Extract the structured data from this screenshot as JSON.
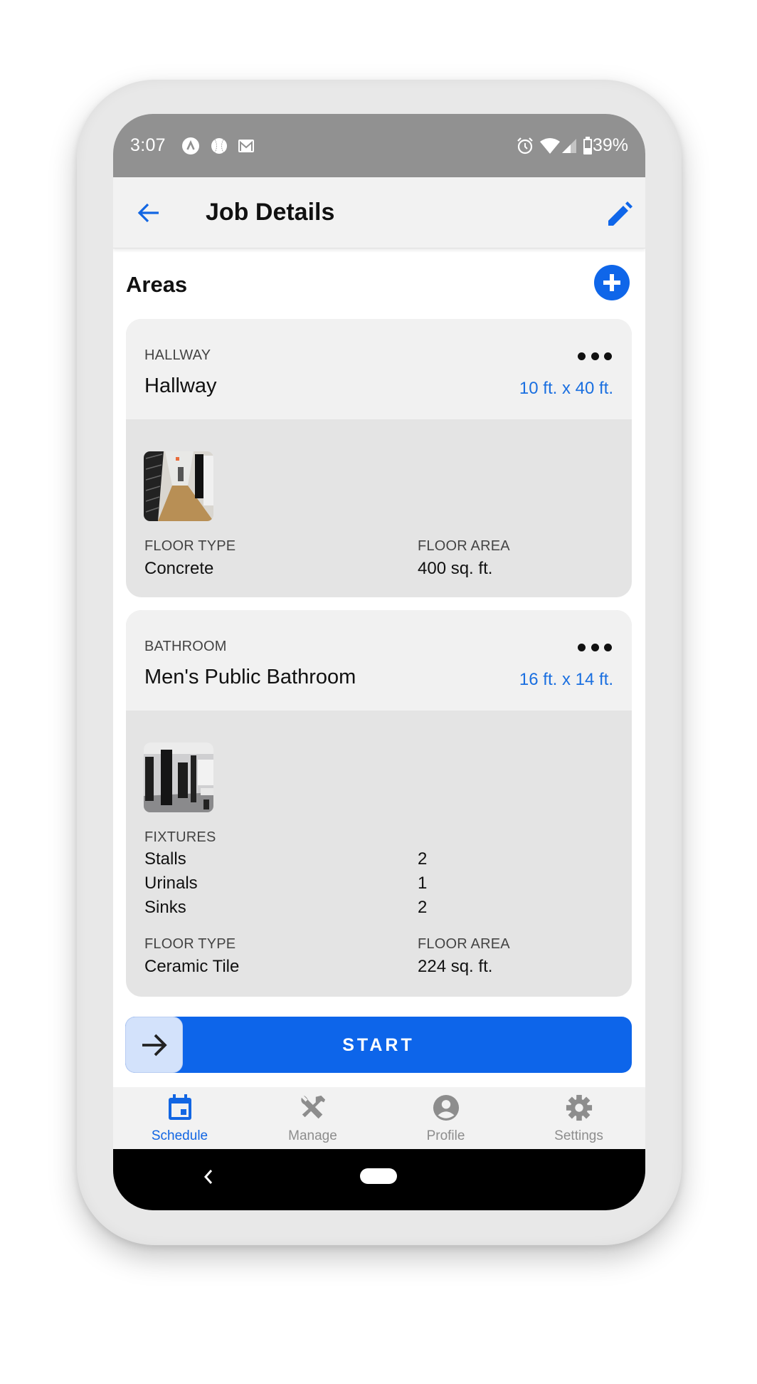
{
  "status_bar": {
    "time": "3:07",
    "left_icons": [
      "app-notification-icon",
      "sports-ball-icon",
      "gmail-icon"
    ],
    "right_icons": [
      "alarm-icon",
      "wifi-icon",
      "cell-signal-icon",
      "battery-icon"
    ],
    "battery_percent": "39%"
  },
  "app_bar": {
    "title": "Job Details",
    "back_icon": "arrow-left-icon",
    "edit_icon": "pencil-icon"
  },
  "section": {
    "title": "Areas",
    "add_icon": "plus-circle-icon"
  },
  "areas": [
    {
      "type": "HALLWAY",
      "name": "Hallway",
      "dimensions": "10 ft. x 40 ft.",
      "photo": "hallway-photo",
      "floor_type_label": "FLOOR TYPE",
      "floor_type": "Concrete",
      "floor_area_label": "FLOOR AREA",
      "floor_area": "400 sq. ft."
    },
    {
      "type": "BATHROOM",
      "name": "Men's Public Bathroom",
      "dimensions": "16 ft. x 14 ft.",
      "photo": "bathroom-photo",
      "fixtures_label": "FIXTURES",
      "fixtures": [
        {
          "name": "Stalls",
          "count": "2"
        },
        {
          "name": "Urinals",
          "count": "1"
        },
        {
          "name": "Sinks",
          "count": "2"
        }
      ],
      "floor_type_label": "FLOOR TYPE",
      "floor_type": "Ceramic Tile",
      "floor_area_label": "FLOOR AREA",
      "floor_area": "224 sq. ft."
    }
  ],
  "start_slider": {
    "label": "START",
    "handle_icon": "arrow-right-icon"
  },
  "tabs": [
    {
      "label": "Schedule",
      "icon": "calendar-icon",
      "active": true
    },
    {
      "label": "Manage",
      "icon": "tools-icon",
      "active": false
    },
    {
      "label": "Profile",
      "icon": "account-circle-icon",
      "active": false
    },
    {
      "label": "Settings",
      "icon": "gear-icon",
      "active": false
    }
  ],
  "colors": {
    "accent": "#0f66e9",
    "dimension_text": "#1a6fe0",
    "status_bar": "#919191",
    "card_header": "#f1f1f1",
    "card_body": "#e4e4e4",
    "inactive_tab": "#8d8d8d"
  }
}
